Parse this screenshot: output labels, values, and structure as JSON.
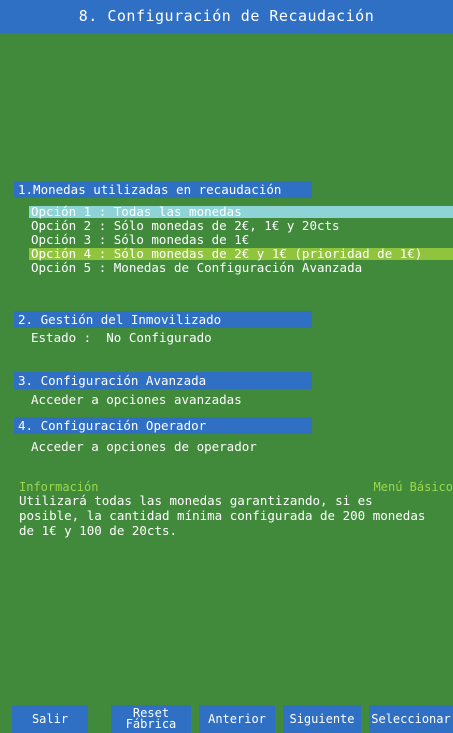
{
  "title": "8. Configuración de Recaudación",
  "sections": [
    {
      "header": "1.Monedas utilizadas en recaudación"
    },
    {
      "header": "2. Gestión del Inmovilizado"
    },
    {
      "header": "3. Configuración Avanzada"
    },
    {
      "header": "4. Configuración Operador"
    }
  ],
  "monedas_options": [
    "Opción 1 : Todas las monedas",
    "Opción 2 : Sólo monedas de 2€, 1€ y 20cts",
    "Opción 3 : Sólo monedas de 1€",
    "Opción 4 : Sólo monedas de 2€ y 1€ (prioridad de 1€)",
    "Opción 5 : Monedas de Configuración Avanzada"
  ],
  "inmovilizado": {
    "estado_label": "Estado :",
    "estado_value": "No Configurado"
  },
  "avanzada_text": "Acceder a opciones avanzadas",
  "operador_text": "Acceder a opciones de operador",
  "info": {
    "title": "Información",
    "mode": "Menú Básico",
    "text": "Utilizará todas las monedas garantizando, si es\nposible, la cantidad mínima configurada  de 200 monedas\nde 1€ y 100 de 20cts."
  },
  "buttons": {
    "salir": "Salir",
    "reset": "Reset\nFábrica",
    "anterior": "Anterior",
    "siguiente": "Siguiente",
    "seleccionar": "Seleccionar"
  },
  "colors": {
    "background": "#418a3c",
    "header_blue": "#2f6fc4",
    "highlight_cyan": "#8ed3d6",
    "highlight_lime": "#8fc43c",
    "info_green": "#9bd84c"
  }
}
